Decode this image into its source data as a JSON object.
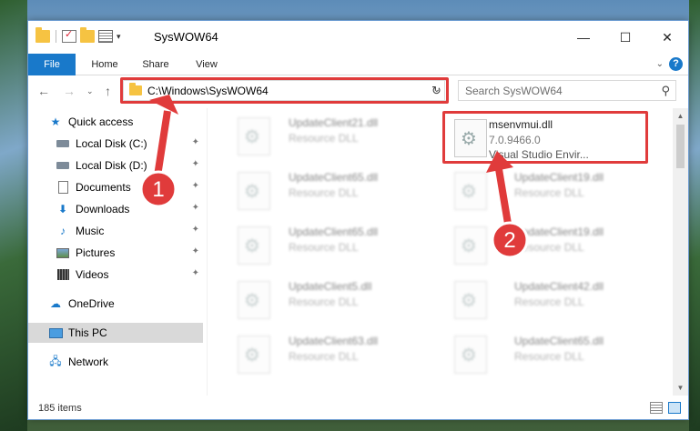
{
  "window": {
    "title": "SysWOW64",
    "minimize_glyph": "—",
    "maximize_glyph": "☐",
    "close_glyph": "✕"
  },
  "ribbon": {
    "tabs": [
      {
        "label": "File"
      },
      {
        "label": "Home"
      },
      {
        "label": "Share"
      },
      {
        "label": "View"
      }
    ],
    "help_glyph": "?",
    "expand_glyph": "⌄"
  },
  "navigation": {
    "back_glyph": "←",
    "forward_glyph": "→",
    "recent_glyph": "⌄",
    "up_glyph": "↑"
  },
  "address": {
    "path": "C:\\Windows\\SysWOW64",
    "dropdown_glyph": "⌄",
    "refresh_glyph": "↻"
  },
  "search": {
    "placeholder": "Search SysWOW64",
    "icon_glyph": "⚲"
  },
  "sidebar": {
    "items": [
      {
        "label": "Quick access",
        "icon": "star-icon",
        "pinned": false
      },
      {
        "label": "Local Disk (C:)",
        "icon": "disk-icon",
        "pinned": true
      },
      {
        "label": "Local Disk (D:)",
        "icon": "disk-icon",
        "pinned": true
      },
      {
        "label": "Documents",
        "icon": "documents-icon",
        "pinned": true
      },
      {
        "label": "Downloads",
        "icon": "downloads-icon",
        "pinned": true
      },
      {
        "label": "Music",
        "icon": "music-icon",
        "pinned": true
      },
      {
        "label": "Pictures",
        "icon": "pictures-icon",
        "pinned": true
      },
      {
        "label": "Videos",
        "icon": "videos-icon",
        "pinned": true
      },
      {
        "label": "OneDrive",
        "icon": "onedrive-icon",
        "pinned": false
      },
      {
        "label": "This PC",
        "icon": "pc-icon",
        "pinned": false,
        "selected": true
      },
      {
        "label": "Network",
        "icon": "network-icon",
        "pinned": false
      }
    ],
    "pin_glyph": "📌"
  },
  "files": {
    "left_column": [
      {
        "name": "UpdateClient21.dll",
        "type": "Resource DLL"
      },
      {
        "name": "UpdateClient65.dll",
        "type": "Resource DLL"
      },
      {
        "name": "UpdateClient65.dll",
        "type": "Resource DLL"
      },
      {
        "name": "UpdateClient5.dll",
        "type": "Resource DLL"
      },
      {
        "name": "UpdateClient63.dll",
        "type": "Resource DLL"
      }
    ],
    "highlighted": {
      "name": "msenvmui.dll",
      "version": "7.0.9466.0",
      "description": "Visual Studio Envir..."
    },
    "right_column": [
      {
        "name": "UpdateClient19.dll",
        "type": "Resource DLL"
      },
      {
        "name": "UpdateClient19.dll",
        "type": "Resource DLL"
      },
      {
        "name": "UpdateClient42.dll",
        "type": "Resource DLL"
      },
      {
        "name": "UpdateClient65.dll",
        "type": "Resource DLL"
      }
    ]
  },
  "status": {
    "item_count": "185 items"
  },
  "annotations": {
    "step1": "1",
    "step2": "2",
    "color": "#e03b3b"
  }
}
